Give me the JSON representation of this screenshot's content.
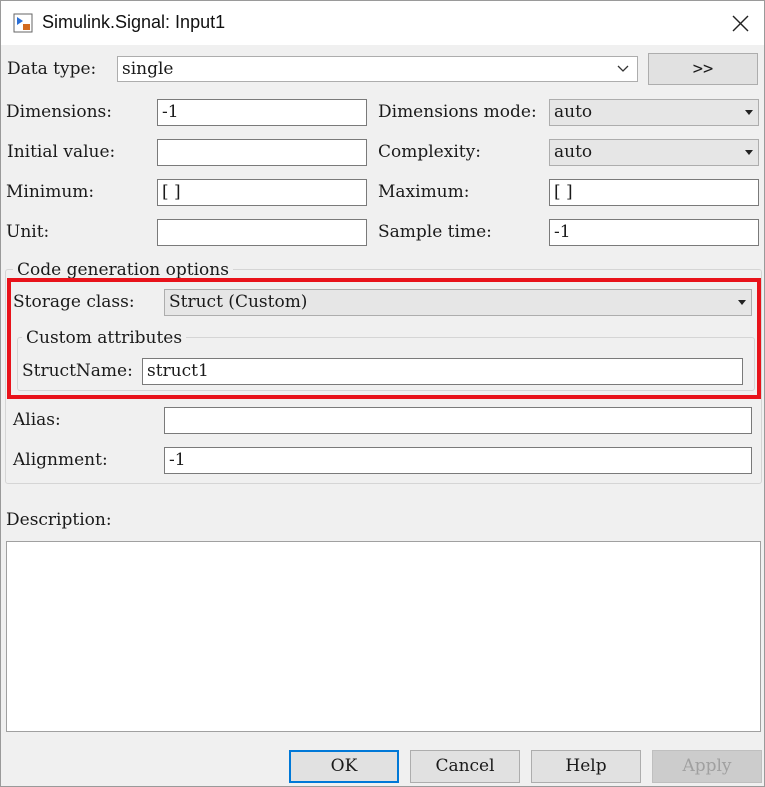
{
  "window": {
    "title": "Simulink.Signal: Input1"
  },
  "data_type": {
    "label": "Data type:",
    "value": "single",
    "expand_button": ">>"
  },
  "dimensions": {
    "label": "Dimensions:",
    "value": "-1"
  },
  "dimensions_mode": {
    "label": "Dimensions mode:",
    "value": "auto"
  },
  "initial_value": {
    "label": "Initial value:",
    "value": ""
  },
  "complexity": {
    "label": "Complexity:",
    "value": "auto"
  },
  "minimum": {
    "label": "Minimum:",
    "value": "[ ]"
  },
  "maximum": {
    "label": "Maximum:",
    "value": "[ ]"
  },
  "unit": {
    "label": "Unit:",
    "value": ""
  },
  "sample_time": {
    "label": "Sample time:",
    "value": "-1"
  },
  "code_generation": {
    "title": "Code generation options",
    "storage_class": {
      "label": "Storage class:",
      "value": "Struct (Custom)"
    },
    "custom_attributes": {
      "title": "Custom attributes",
      "struct_name": {
        "label": "StructName:",
        "value": "struct1"
      }
    },
    "alias": {
      "label": "Alias:",
      "value": ""
    },
    "alignment": {
      "label": "Alignment:",
      "value": "-1"
    }
  },
  "description": {
    "label": "Description:",
    "value": ""
  },
  "buttons": {
    "ok": "OK",
    "cancel": "Cancel",
    "help": "Help",
    "apply": "Apply"
  },
  "colors": {
    "highlight": "#e8121a",
    "default_button_border": "#0078d7"
  },
  "icons": {
    "app": "simulink-block-icon",
    "close": "close-icon",
    "dropdown": "chevron-down-icon"
  }
}
